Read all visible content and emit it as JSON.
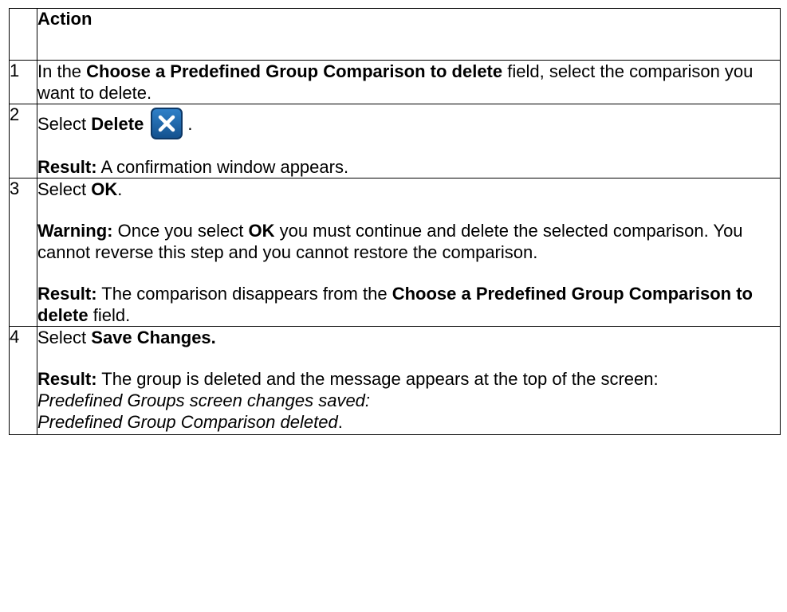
{
  "table": {
    "header": {
      "num": "",
      "action": "Action"
    },
    "rows": [
      {
        "num": "1",
        "s1": "In the ",
        "s1b": "Choose a Predefined Group Comparison to delete",
        "s1c": " field, select the comparison you want to delete."
      },
      {
        "num": "2",
        "select": "Select ",
        "delete": "Delete",
        "period": ".",
        "icon": "close-x-icon",
        "result_label": "Result:",
        "result_text": " A confirmation window appears."
      },
      {
        "num": "3",
        "select": "Select ",
        "ok": "OK",
        "period": ".",
        "warning_label": "Warning:",
        "warning_a": " Once you select ",
        "warning_ok": "OK",
        "warning_b": " you must continue and delete the selected comparison. You cannot reverse this step and you cannot restore the comparison.",
        "result_label": "Result:",
        "result_a": " The comparison disappears from the ",
        "result_field": "Choose a Predefined Group Comparison to delete",
        "result_b": " field."
      },
      {
        "num": "4",
        "select": "Select ",
        "save": "Save Changes.",
        "result_label": "Result:",
        "result_text": " The group is deleted and the message appears at the top of the screen:",
        "message_line1": "Predefined Groups screen changes saved:",
        "message_line2": "Predefined Group Comparison deleted",
        "message_period": "."
      }
    ]
  },
  "colors": {
    "icon_fill": "#1f6bb0",
    "border": "#000000"
  }
}
